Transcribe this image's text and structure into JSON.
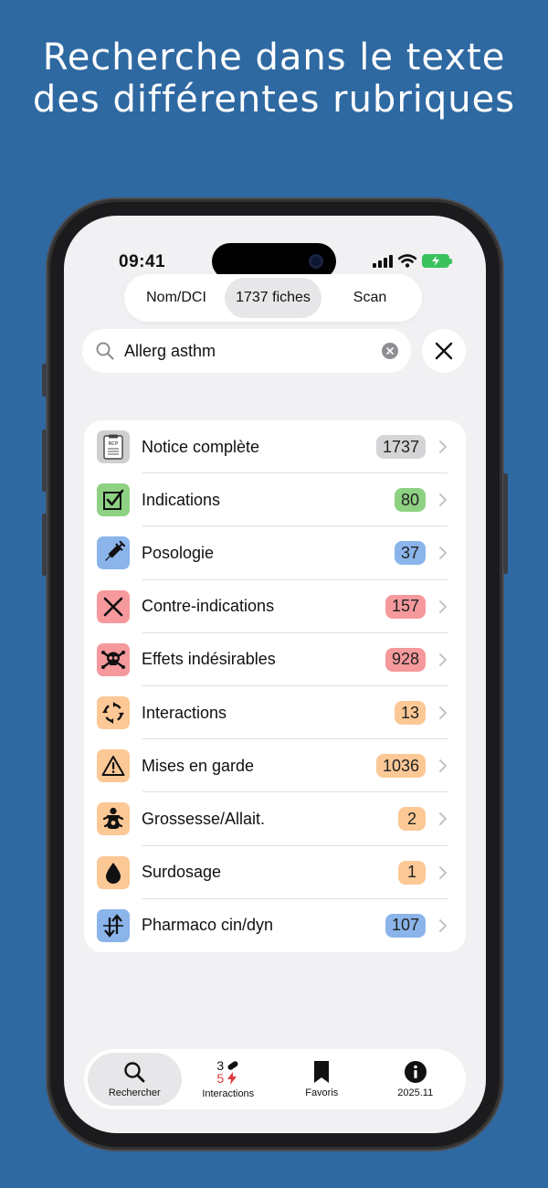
{
  "headline": {
    "line1": "Recherche dans le texte",
    "line2": "des différentes rubriques"
  },
  "status_bar": {
    "time": "09:41"
  },
  "segmented": {
    "items": [
      {
        "label": "Nom/DCI",
        "active": false
      },
      {
        "label": "1737 fiches",
        "active": true
      },
      {
        "label": "Scan",
        "active": false
      }
    ]
  },
  "search": {
    "value": "Allerg asthm",
    "placeholder": ""
  },
  "categories": [
    {
      "label": "Notice complète",
      "count": "1737",
      "icon": "rcp-document-icon",
      "tile_color": "#cfcfd2",
      "badge_color": "#d5d5d8"
    },
    {
      "label": "Indications",
      "count": "80",
      "icon": "checkbox-icon",
      "tile_color": "#8fd183",
      "badge_color": "#8fd183"
    },
    {
      "label": "Posologie",
      "count": "37",
      "icon": "syringe-icon",
      "tile_color": "#8bb5ea",
      "badge_color": "#8bb5ea"
    },
    {
      "label": "Contre-indications",
      "count": "157",
      "icon": "cross-icon",
      "tile_color": "#f5999c",
      "badge_color": "#f5999c"
    },
    {
      "label": "Effets indésirables",
      "count": "928",
      "icon": "skull-icon",
      "tile_color": "#f5999c",
      "badge_color": "#f5999c"
    },
    {
      "label": "Interactions",
      "count": "13",
      "icon": "arrows-circle-icon",
      "tile_color": "#fbc896",
      "badge_color": "#fbc896"
    },
    {
      "label": "Mises en garde",
      "count": "1036",
      "icon": "warning-icon",
      "tile_color": "#fbc896",
      "badge_color": "#fbc896"
    },
    {
      "label": "Grossesse/Allait.",
      "count": "2",
      "icon": "baby-icon",
      "tile_color": "#fbc896",
      "badge_color": "#fbc896"
    },
    {
      "label": "Surdosage",
      "count": "1",
      "icon": "drop-icon",
      "tile_color": "#fbc896",
      "badge_color": "#fbc896"
    },
    {
      "label": "Pharmaco cin/dyn",
      "count": "107",
      "icon": "up-down-arrows-icon",
      "tile_color": "#8bb5ea",
      "badge_color": "#8bb5ea"
    }
  ],
  "tabbar": {
    "search_label": "Rechercher",
    "interactions_label": "Interactions",
    "interactions_top": "3",
    "interactions_bottom": "5",
    "favorites_label": "Favoris",
    "info_label": "2025.11"
  }
}
